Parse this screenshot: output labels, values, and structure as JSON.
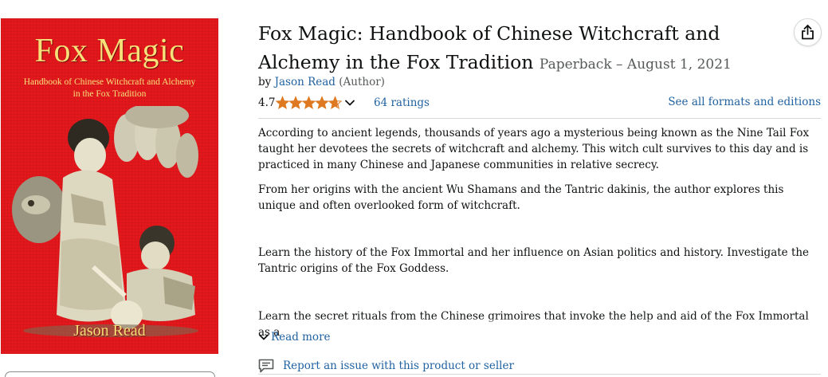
{
  "cover": {
    "title": "Fox Magic",
    "subtitle_line1": "Handbook of Chinese Witchcraft and Alchemy",
    "subtitle_line2": "in the Fox Tradition",
    "author": "Jason Read",
    "background_color": "#e4181c",
    "text_color": "#f6e07a"
  },
  "product": {
    "title": "Fox Magic: Handbook of Chinese Witchcraft and Alchemy in the Fox Tradition",
    "format_date": "Paperback – August 1, 2021",
    "by_prefix": "by",
    "author": "Jason Read",
    "author_role": "(Author)",
    "rating": "4.7",
    "rating_value": 4.7,
    "ratings_count": "64 ratings",
    "formats_link": "See all formats and editions",
    "share_icon": "share-icon"
  },
  "description": {
    "paragraphs": [
      "According to ancient legends, thousands of years ago a mysterious being known as the Nine Tail Fox taught her devotees the secrets of witchcraft and alchemy. This witch cult survives to this day and is practiced in many Chinese and Japanese communities in relative secrecy.",
      "From her origins with the ancient Wu Shamans and the Tantric dakinis, the author explores this unique and often overlooked form of witchcraft.",
      "Learn the history of the Fox Immortal and her influence on Asian politics and history. Investigate the Tantric origins of the Fox Goddess.",
      "Learn the secret rituals from the Chinese grimoires that invoke the help and aid of the Fox Immortal as a"
    ],
    "read_more": "Read more"
  },
  "report": {
    "label": "Report an issue with this product or seller"
  },
  "colors": {
    "link": "#2162a1",
    "star": "#de7921",
    "text": "#0f1111",
    "muted": "#565959"
  }
}
